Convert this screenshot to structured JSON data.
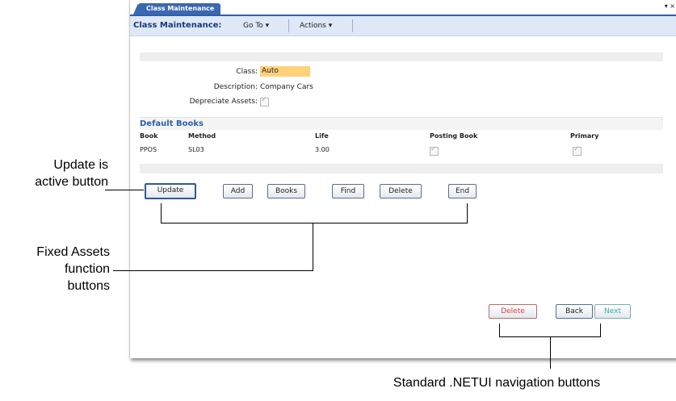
{
  "window": {
    "tab_label": "Class Maintenance",
    "controls": "▾ ×"
  },
  "menubar": {
    "title": "Class Maintenance:",
    "goto_label": "Go To ▾",
    "actions_label": "Actions ▾"
  },
  "form": {
    "class_label": "Class:",
    "class_value": "Auto",
    "description_label": "Description:",
    "description_value": "Company Cars",
    "depreciate_label": "Depreciate Assets:",
    "depreciate_checked": true
  },
  "default_books": {
    "heading": "Default Books",
    "columns": [
      "Book",
      "Method",
      "Life",
      "Posting Book",
      "Primary"
    ],
    "rows": [
      {
        "book": "PPOS",
        "method": "SL03",
        "life": "3.00",
        "posting_book": true,
        "primary": true
      }
    ]
  },
  "function_buttons": {
    "update": "Update",
    "add": "Add",
    "books": "Books",
    "find": "Find",
    "delete": "Delete",
    "end": "End"
  },
  "nav_buttons": {
    "delete": "Delete",
    "back": "Back",
    "next": "Next"
  },
  "annotations": {
    "update_note_line1": "Update is",
    "update_note_line2": "active button",
    "fixed_note_line1": "Fixed Assets",
    "fixed_note_line2": "function",
    "fixed_note_line3": "buttons",
    "nav_note": "Standard .NETUI navigation buttons"
  },
  "colors": {
    "accent": "#3b68b0",
    "class_highlight": "#ffd27a",
    "delete_red": "#e23b3b",
    "next_teal": "#3ab0a8"
  }
}
